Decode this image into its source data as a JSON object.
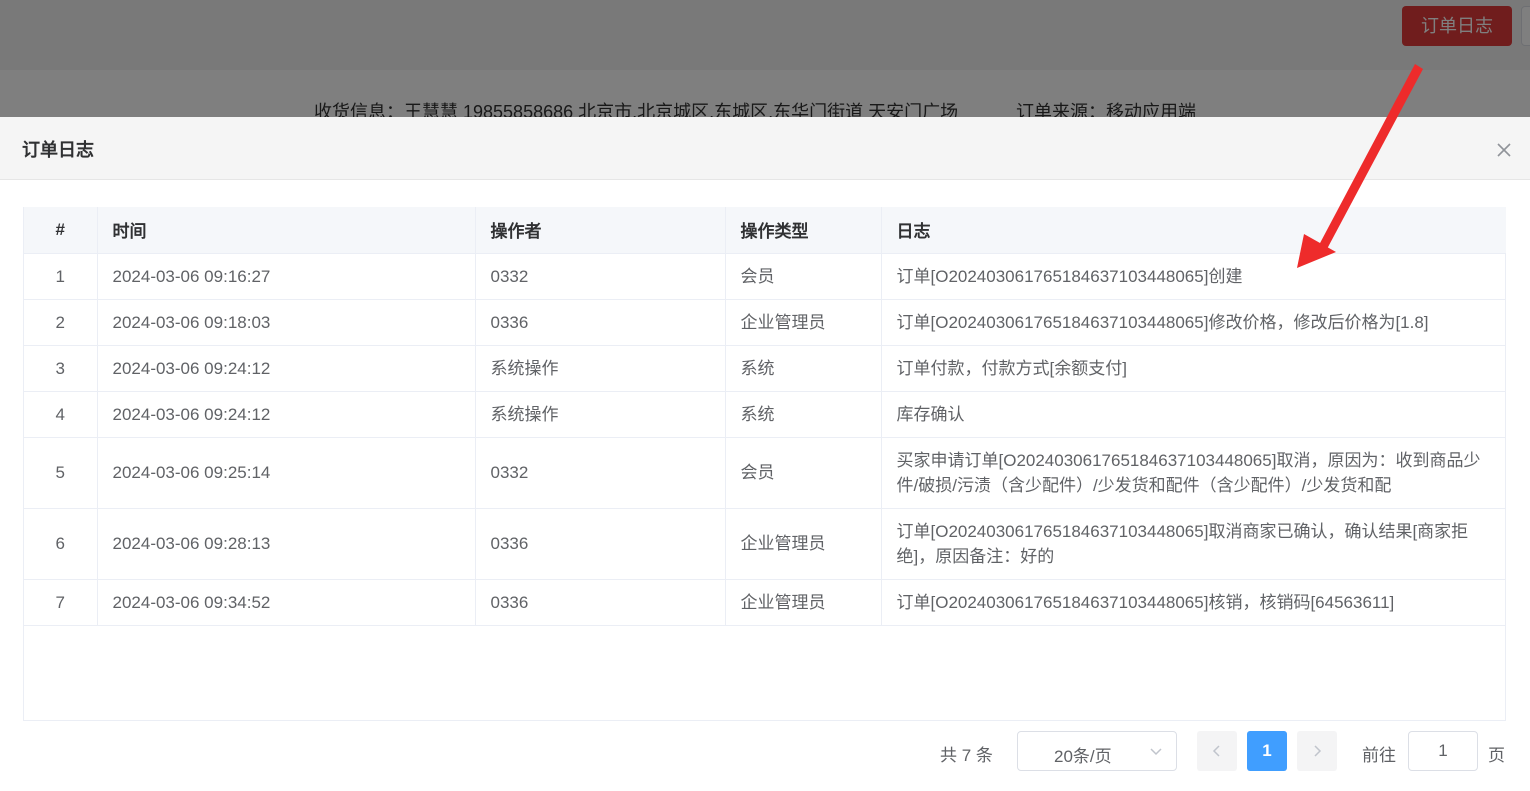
{
  "background": {
    "order_log_button": "订单日志",
    "shipping_info": "收货信息：王慧慧 19855858686 北京市,北京城区,东城区,东华门街道 天安门广场",
    "order_source": "订单来源：移动应用端"
  },
  "dialog": {
    "title": "订单日志",
    "close_icon": "close-icon"
  },
  "table": {
    "headers": [
      "#",
      "时间",
      "操作者",
      "操作类型",
      "日志"
    ],
    "rows": [
      {
        "index": "1",
        "time": "2024-03-06 09:16:27",
        "operator": "0332",
        "type": "会员",
        "log": "订单[O202403061765184637103448065]创建"
      },
      {
        "index": "2",
        "time": "2024-03-06 09:18:03",
        "operator": "0336",
        "type": "企业管理员",
        "log": "订单[O202403061765184637103448065]修改价格，修改后价格为[1.8]"
      },
      {
        "index": "3",
        "time": "2024-03-06 09:24:12",
        "operator": "系统操作",
        "type": "系统",
        "log": "订单付款，付款方式[余额支付]"
      },
      {
        "index": "4",
        "time": "2024-03-06 09:24:12",
        "operator": "系统操作",
        "type": "系统",
        "log": "库存确认"
      },
      {
        "index": "5",
        "time": "2024-03-06 09:25:14",
        "operator": "0332",
        "type": "会员",
        "log": "买家申请订单[O202403061765184637103448065]取消，原因为：收到商品少件/破损/污渍（含少配件）/少发货和配件（含少配件）/少发货和配"
      },
      {
        "index": "6",
        "time": "2024-03-06 09:28:13",
        "operator": "0336",
        "type": "企业管理员",
        "log": "订单[O202403061765184637103448065]取消商家已确认，确认结果[商家拒绝]，原因备注：好的"
      },
      {
        "index": "7",
        "time": "2024-03-06 09:34:52",
        "operator": "0336",
        "type": "企业管理员",
        "log": "订单[O202403061765184637103448065]核销，核销码[64563611]"
      }
    ]
  },
  "pagination": {
    "total": "共 7 条",
    "page_size": "20条/页",
    "current_page": "1",
    "goto_label": "前往",
    "goto_value": "1",
    "goto_suffix": "页"
  },
  "colors": {
    "accent": "#409eff",
    "log_button": "#e03a3a",
    "annotation_arrow": "#ee2b2b"
  }
}
